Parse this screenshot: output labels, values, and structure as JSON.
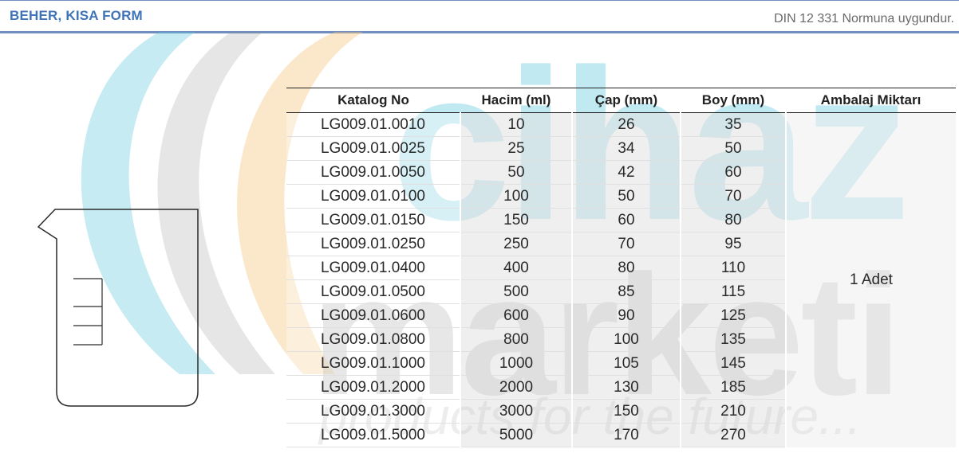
{
  "header": {
    "title": "BEHER, KISA FORM",
    "note": "DIN 12 331 Normuna uygundur."
  },
  "watermark": {
    "line1": "cihaz",
    "line2": "marketi",
    "tagline": "products for the future..."
  },
  "table": {
    "columns": [
      "Katalog No",
      "Hacim (ml)",
      "Çap (mm)",
      "Boy (mm)",
      "Ambalaj Miktarı"
    ],
    "rows": [
      [
        "LG009.01.0010",
        "10",
        "26",
        "35"
      ],
      [
        "LG009.01.0025",
        "25",
        "34",
        "50"
      ],
      [
        "LG009.01.0050",
        "50",
        "42",
        "60"
      ],
      [
        "LG009.01.0100",
        "100",
        "50",
        "70"
      ],
      [
        "LG009.01.0150",
        "150",
        "60",
        "80"
      ],
      [
        "LG009.01.0250",
        "250",
        "70",
        "95"
      ],
      [
        "LG009.01.0400",
        "400",
        "80",
        "110"
      ],
      [
        "LG009.01.0500",
        "500",
        "85",
        "115"
      ],
      [
        "LG009.01.0600",
        "600",
        "90",
        "125"
      ],
      [
        "LG009.01.0800",
        "800",
        "100",
        "135"
      ],
      [
        "LG009.01.1000",
        "1000",
        "105",
        "145"
      ],
      [
        "LG009.01.2000",
        "2000",
        "130",
        "185"
      ],
      [
        "LG009.01.3000",
        "3000",
        "150",
        "210"
      ],
      [
        "LG009.01.5000",
        "5000",
        "170",
        "270"
      ]
    ],
    "packaging": "1 Adet"
  },
  "colors": {
    "header_text": "#3f74b8",
    "header_rule": "#6f8fbf",
    "watermark_cyan": "#5bc6dc",
    "watermark_orange": "#f6c37a",
    "watermark_gray": "#8f8f8f"
  }
}
